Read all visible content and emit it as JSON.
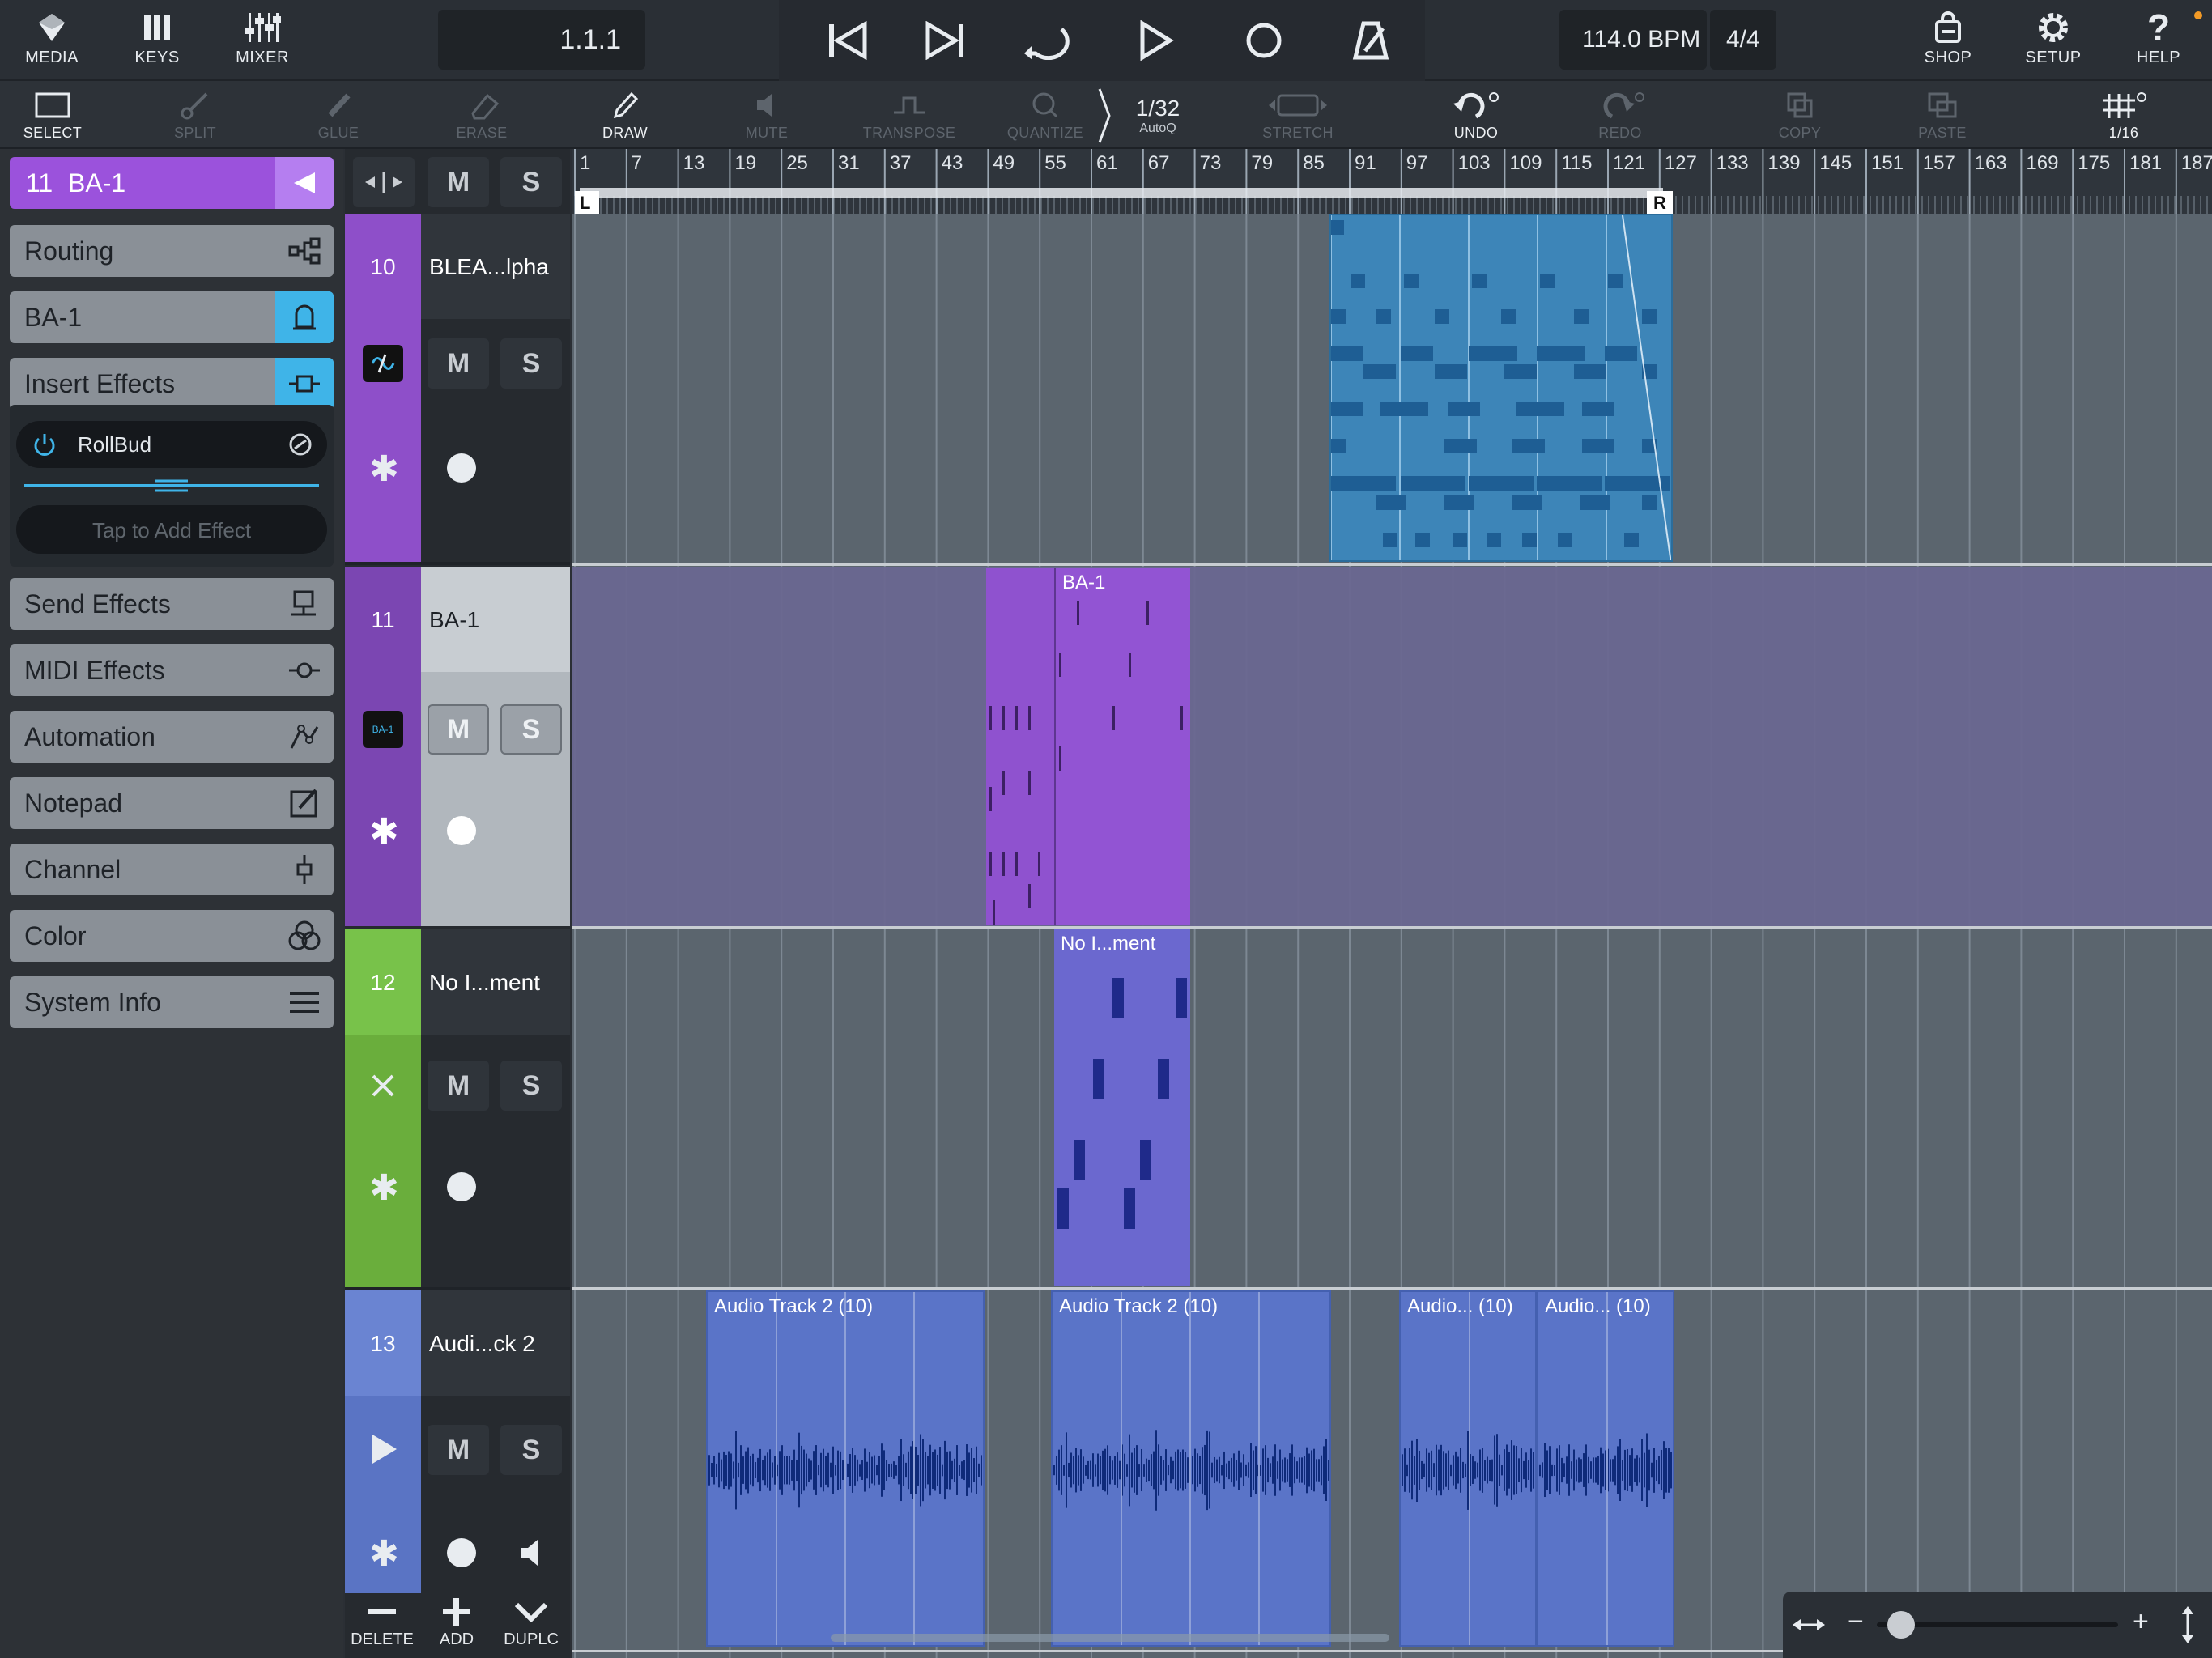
{
  "topbar": {
    "media_label": "MEDIA",
    "keys_label": "KEYS",
    "mixer_label": "MIXER",
    "position": "1.1.1",
    "tempo": "114.0 BPM",
    "time_signature": "4/4",
    "shop_label": "SHOP",
    "setup_label": "SETUP",
    "help_label": "HELP"
  },
  "toolbar": {
    "select": "SELECT",
    "split": "SPLIT",
    "glue": "GLUE",
    "erase": "ERASE",
    "draw": "DRAW",
    "mute": "MUTE",
    "transpose": "TRANSPOSE",
    "quantize": "QUANTIZE",
    "quant_value": "1/32",
    "quant_mode": "AutoQ",
    "stretch": "STRETCH",
    "undo": "UNDO",
    "redo": "REDO",
    "copy": "COPY",
    "paste": "PASTE",
    "grid_value": "1/16"
  },
  "inspector": {
    "track_number": "11",
    "track_name": "BA-1",
    "routing": "Routing",
    "instrument": "BA-1",
    "insert_effects": "Insert Effects",
    "effect_name": "RollBud",
    "add_effect": "Tap to Add Effect",
    "send_effects": "Send Effects",
    "midi_effects": "MIDI Effects",
    "automation": "Automation",
    "notepad": "Notepad",
    "channel": "Channel",
    "color": "Color",
    "system_info": "System Info"
  },
  "tracks": [
    {
      "number": "10",
      "name": "BLEA...lpha",
      "color": "#8e4fc9"
    },
    {
      "number": "11",
      "name": "BA-1",
      "color": "#8e4fc9"
    },
    {
      "number": "12",
      "name": "No I...ment",
      "color": "#6aae3c"
    },
    {
      "number": "13",
      "name": "Audi...ck 2",
      "color": "#5a74c4"
    }
  ],
  "ms": {
    "mute": "M",
    "solo": "S"
  },
  "ruler": {
    "bars": [
      "1",
      "7",
      "13",
      "19",
      "25",
      "31",
      "37",
      "43",
      "49",
      "55",
      "61",
      "67",
      "73",
      "79",
      "85",
      "91",
      "97",
      "103",
      "109",
      "115",
      "121",
      "127",
      "133",
      "139",
      "145",
      "151",
      "157",
      "163",
      "169",
      "175",
      "181",
      "187"
    ],
    "left_locator": "L",
    "right_locator": "R"
  },
  "clips": {
    "ba1": "BA-1",
    "noinst": "No I...ment",
    "audio1": "Audio Track 2 (10)",
    "audio2": "Audio Track 2 (10)",
    "audio3": "Audio... (10)",
    "audio4": "Audio... (10)"
  },
  "bottom": {
    "delete": "DELETE",
    "add": "ADD",
    "duplicate": "DUPLC"
  },
  "zoom": {
    "minus": "−",
    "plus": "+",
    "level_fraction": 0.05
  }
}
